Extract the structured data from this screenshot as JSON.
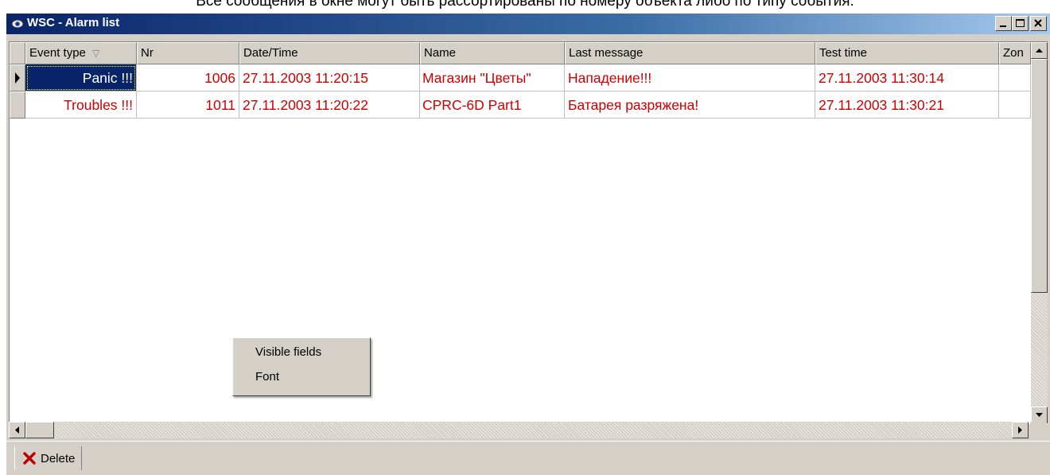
{
  "caption": "Все сообщения в окне могут быть рассортированы по номеру объекта либо по типу события.",
  "window": {
    "title": "WSC - Alarm list",
    "controls": [
      "minimize-icon",
      "maximize-icon",
      "close-icon"
    ]
  },
  "columns": [
    {
      "label": "Event type"
    },
    {
      "label": "Nr"
    },
    {
      "label": "Date/Time"
    },
    {
      "label": "Name"
    },
    {
      "label": "Last message"
    },
    {
      "label": "Test time"
    },
    {
      "label": "Zon"
    }
  ],
  "sort_indicator": "▽",
  "rows": [
    {
      "event_type": "Panic !!!",
      "nr": "1006",
      "datetime": "27.11.2003 11:20:15",
      "name": "Магазин \"Цветы\"",
      "last_message": "Нападение!!!",
      "test_time": "27.11.2003 11:30:14",
      "zone": "",
      "selected": true
    },
    {
      "event_type": "Troubles !!!",
      "nr": "1011",
      "datetime": "27.11.2003 11:20:22",
      "name": "CPRC-6D Part1",
      "last_message": "Батарея разряжена!",
      "test_time": "27.11.2003 11:30:21",
      "zone": "",
      "selected": false
    }
  ],
  "context_menu": {
    "items": [
      "Visible fields",
      "Font"
    ]
  },
  "toolbar": {
    "delete_label": "Delete",
    "delete_icon": "red-x-icon"
  },
  "colors": {
    "row_text": "#cc0000",
    "selection": "#0a246a",
    "face": "#d4d0c8"
  }
}
